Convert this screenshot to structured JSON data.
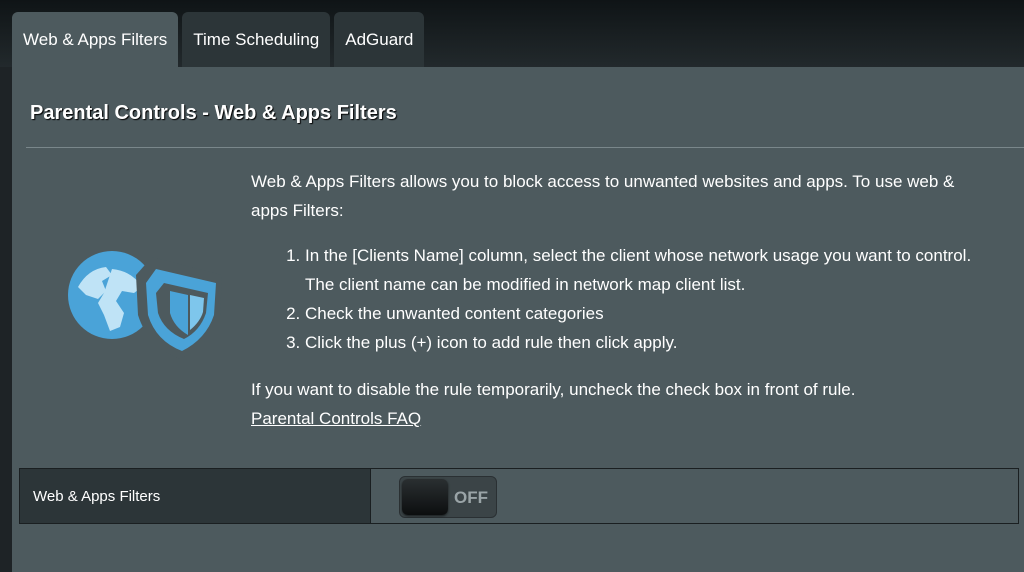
{
  "tabs": [
    {
      "label": "Web & Apps Filters",
      "active": true
    },
    {
      "label": "Time Scheduling",
      "active": false
    },
    {
      "label": "AdGuard",
      "active": false
    }
  ],
  "page": {
    "title": "Parental Controls - Web & Apps Filters",
    "intro": "Web & Apps Filters allows you to block access to unwanted websites and apps. To use web & apps Filters:",
    "steps": [
      "In the [Clients Name] column, select the client whose network usage you want to control. The client name can be modified in network map client list.",
      "Check the unwanted content categories",
      "Click the plus (+) icon to add rule then click apply."
    ],
    "note": "If you want to disable the rule temporarily, uncheck the check box in front of rule.",
    "faq_link": "Parental Controls FAQ"
  },
  "setting": {
    "label": "Web & Apps Filters",
    "toggle_state": "OFF"
  },
  "icons": {
    "logo": "globe-shield-icon"
  },
  "colors": {
    "accent": "#4aa3d8",
    "panel": "#4d5a5e",
    "tab_inactive": "#2c3538"
  }
}
